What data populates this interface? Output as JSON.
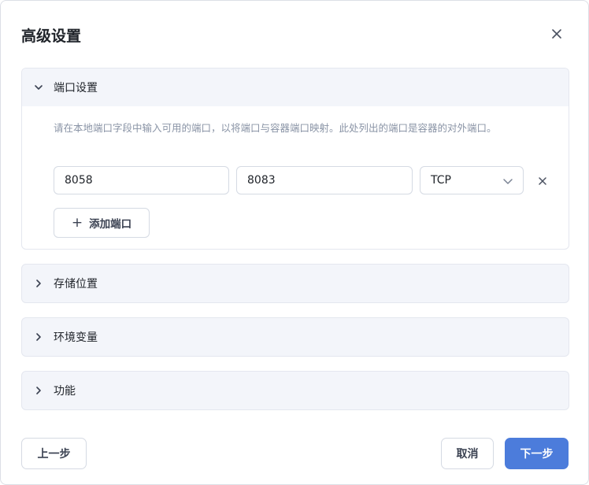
{
  "dialog": {
    "title": "高级设置",
    "close_icon": "close-icon"
  },
  "sections": {
    "ports": {
      "title": "端口设置",
      "expanded": true,
      "description": "请在本地端口字段中输入可用的端口，以将端口与容器端口映射。此处列出的端口是容器的对外端口。",
      "rows": [
        {
          "host_port": "8058",
          "container_port": "8083",
          "protocol": "TCP"
        }
      ],
      "add_label": "添加端口"
    },
    "storage": {
      "title": "存储位置",
      "expanded": false
    },
    "env": {
      "title": "环境变量",
      "expanded": false
    },
    "features": {
      "title": "功能",
      "expanded": false
    }
  },
  "footer": {
    "prev_label": "上一步",
    "cancel_label": "取消",
    "next_label": "下一步"
  },
  "colors": {
    "primary": "#4c7cdb",
    "section_bg": "#f3f5fa",
    "muted_text": "#8a94a6"
  }
}
